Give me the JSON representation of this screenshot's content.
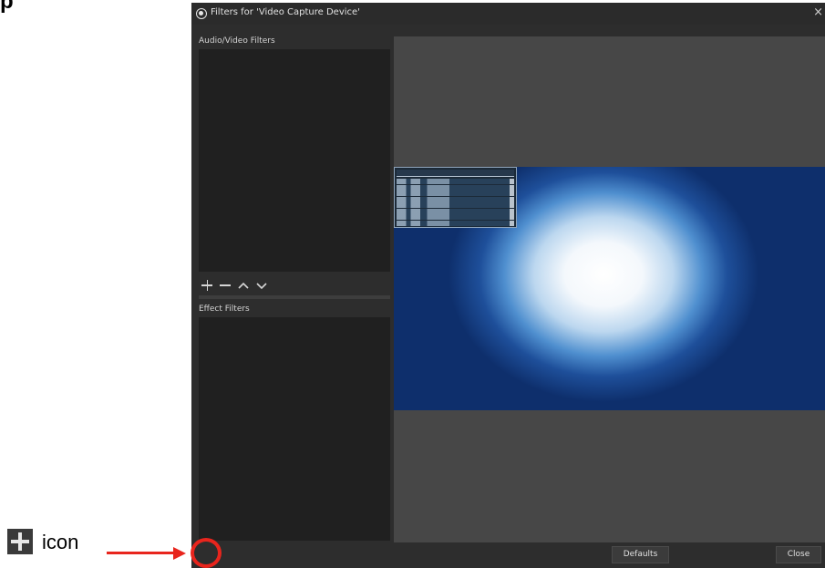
{
  "annotation": {
    "top_fragment": "p",
    "icon_label": "icon",
    "accent_color": "#e8251d"
  },
  "window": {
    "title": "Filters for 'Video Capture Device'",
    "close_symbol": "×",
    "audio_video": {
      "label": "Audio/Video Filters"
    },
    "effect": {
      "label": "Effect Filters"
    },
    "toolbar_icons": [
      "plus-icon",
      "minus-icon",
      "chevron-up-icon",
      "chevron-down-icon"
    ],
    "buttons": {
      "defaults": "Defaults",
      "close": "Close"
    }
  }
}
